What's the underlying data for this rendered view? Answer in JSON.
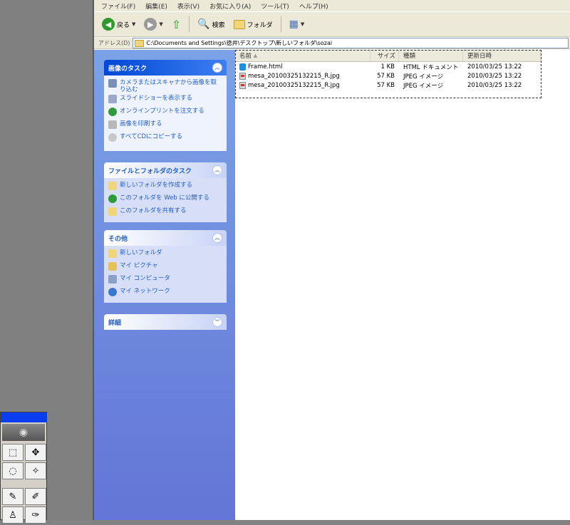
{
  "menu": [
    "ファイル(F)",
    "編集(E)",
    "表示(V)",
    "お気に入り(A)",
    "ツール(T)",
    "ヘルプ(H)"
  ],
  "toolbar": {
    "back_label": "戻る",
    "search_label": "検索",
    "folders_label": "フォルダ"
  },
  "address": {
    "label": "アドレス(D)",
    "value": "C:\\Documents and Settings\\徳井\\デスクトップ\\新しいフォルダ\\sozai"
  },
  "panels": {
    "image_tasks": {
      "title": "画像のタスク",
      "items": [
        "カメラまたはスキャナから画像を取り込む",
        "スライドショーを表示する",
        "オンラインプリントを注文する",
        "画像を印刷する",
        "すべてCDにコピーする"
      ]
    },
    "file_tasks": {
      "title": "ファイルとフォルダのタスク",
      "items": [
        "新しいフォルダを作成する",
        "このフォルダを Web に公開する",
        "このフォルダを共有する"
      ]
    },
    "other": {
      "title": "その他",
      "items": [
        "新しいフォルダ",
        "マイ ピクチャ",
        "マイ コンピュータ",
        "マイ ネットワーク"
      ]
    },
    "details": {
      "title": "詳細"
    }
  },
  "columns": {
    "name": "名前",
    "size": "サイズ",
    "type": "種類",
    "date": "更新日時"
  },
  "files": [
    {
      "name": "Frame.html",
      "size": "1 KB",
      "type": "HTML ドキュメント",
      "date": "2010/03/25 13:22"
    },
    {
      "name": "mesa_20100325132215_R.jpg",
      "size": "57 KB",
      "type": "JPEG イメージ",
      "date": "2010/03/25 13:22"
    },
    {
      "name": "mesa_20100325132215_R.jpg",
      "size": "57 KB",
      "type": "JPEG イメージ",
      "date": "2010/03/25 13:22"
    }
  ],
  "colors": {
    "taskpane_top": "#7ba2e7",
    "taskpane_bottom": "#6375d6",
    "panel_header_blue": "#0048d5",
    "link_blue": "#215dc6"
  }
}
